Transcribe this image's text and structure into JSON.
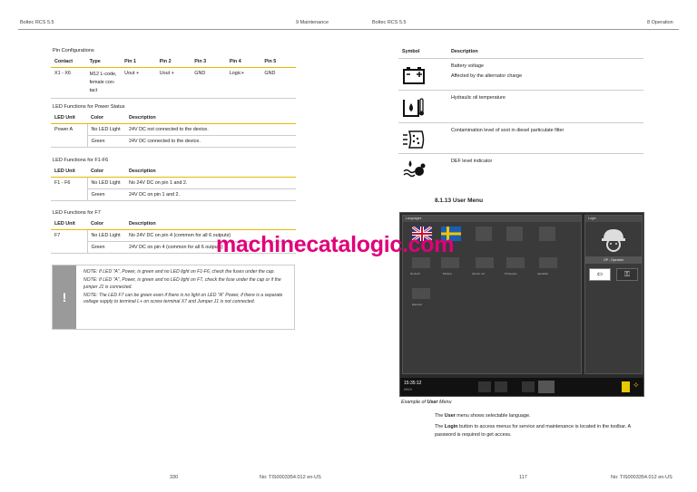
{
  "left_page": {
    "header_left": "Boltec RCS 5.5",
    "header_right": "9 Maintenance",
    "footer_page": "330",
    "footer_doc": "No: TIS0003354.012 en-US",
    "pin_config": {
      "title": "Pin Configurations",
      "headers": [
        "Contact",
        "Type",
        "Pin 1",
        "Pin 2",
        "Pin 3",
        "Pin 4",
        "Pin 5"
      ],
      "rows": [
        [
          "X1 - X6",
          "M12 L-code, female con-tact",
          "Uout +",
          "Uout +",
          "GND",
          "Logic+",
          "GND"
        ]
      ]
    },
    "led_power": {
      "title": "LED Functions for Power Status",
      "headers": [
        "LED Unit",
        "Color",
        "Description"
      ],
      "unit": "Power A",
      "rows": [
        [
          "No LED Light",
          "24V DC not connected to the device."
        ],
        [
          "Green",
          "24V DC connected to the device."
        ]
      ]
    },
    "led_f1f6": {
      "title": "LED Functions for F1-F6",
      "headers": [
        "LED Unit",
        "Color",
        "Description"
      ],
      "unit": "F1 - F6",
      "rows": [
        [
          "No LED Light",
          "No 24V DC on pin 1 and 2."
        ],
        [
          "Green",
          "24V DC on pin 1 and 2."
        ]
      ]
    },
    "led_f7": {
      "title": "LED Functions for F7",
      "headers": [
        "LED Unit",
        "Color",
        "Description"
      ],
      "unit": "F7",
      "rows": [
        [
          "No LED Light",
          "No 24V DC on pin 4 (common for all 6 outputs)"
        ],
        [
          "Green",
          "24V DC on pin 4 (common for all 6 outputs)"
        ]
      ]
    },
    "note": {
      "icon": "!",
      "p1": "NOTE: If LED \"A\", Power, is green and no LED light on F1-F6, check the fuses under the cap.",
      "p2": "NOTE: If LED \"A\", Power, is green and no LED light on F7, check the fuse under the cap or if the jumper J1 is connected.",
      "p3": "NOTE: The LED F7 can be green even if there is no light on LED \"A\" Power, if there is a separate voltage supply to terminal L+ on screw terminal X7 and Jumper J1 is not connected."
    }
  },
  "right_page": {
    "header_left": "Boltec RCS 5.5",
    "header_right": "8 Operation",
    "footer_page": "117",
    "footer_doc": "No: TIS0003354.012 en-US",
    "symbols": {
      "headers": [
        "Symbol",
        "Description"
      ],
      "rows": [
        {
          "icon": "battery-icon",
          "lines": [
            "Battery voltage",
            "Affected by the alternator charge"
          ]
        },
        {
          "icon": "hydraulic-oil-temperature-icon",
          "lines": [
            "Hydraulic oil temperature"
          ]
        },
        {
          "icon": "particulate-filter-icon",
          "lines": [
            "Contamination level of soot in diesel particulate filter"
          ]
        },
        {
          "icon": "def-level-icon",
          "lines": [
            "DEF level indicator"
          ]
        }
      ]
    },
    "section_heading": "8.1.13 User Menu",
    "screen": {
      "languages_label": "Languages",
      "login_label": "Login",
      "lang_row1": [
        "",
        "",
        "",
        "",
        "",
        ""
      ],
      "lang_labels": [
        "",
        "",
        "",
        "",
        "",
        "",
        "",
        "",
        "",
        "",
        "",
        ""
      ],
      "lang_row2": [
        "Deutsch",
        "Molana",
        "Ianrion nor",
        "Portugues",
        "Iqocalalo"
      ],
      "lang_row3": [
        "Espanol"
      ],
      "operator_label": "OP - Operator",
      "time": "15:35:12",
      "date": "09/19"
    },
    "watermark": "machinecatalogic.com",
    "caption_prefix": "Example of ",
    "caption_bold": "User",
    "caption_suffix": " Menu",
    "para1_a": "The ",
    "para1_b": "User",
    "para1_c": " menu shows selectable language.",
    "para2_a": "The ",
    "para2_b": "Login",
    "para2_c": " button to access menus for service and maintenance is located in the toolbar. A password is required to get access."
  }
}
